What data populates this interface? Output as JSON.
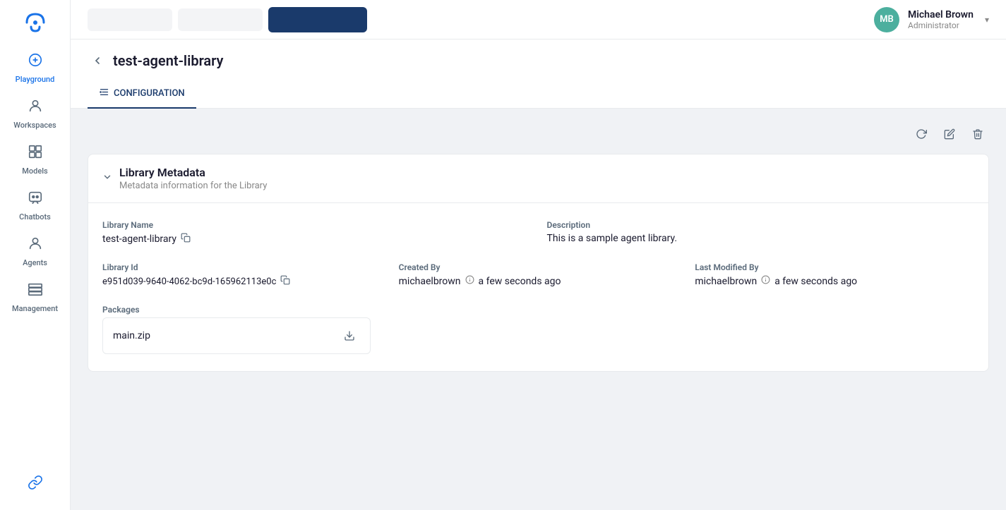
{
  "app": {
    "logo_alt": "AI Logo"
  },
  "user": {
    "initials": "MB",
    "name": "Michael Brown",
    "role": "Administrator"
  },
  "sidebar": {
    "items": [
      {
        "id": "playground",
        "label": "Playground",
        "icon": "💬",
        "active": true
      },
      {
        "id": "workspaces",
        "label": "Workspaces",
        "icon": "☁️",
        "active": false
      },
      {
        "id": "models",
        "label": "Models",
        "icon": "⊞",
        "active": false
      },
      {
        "id": "chatbots",
        "label": "Chatbots",
        "icon": "🤖",
        "active": false
      },
      {
        "id": "agents",
        "label": "Agents",
        "icon": "👤",
        "active": false
      },
      {
        "id": "management",
        "label": "Management",
        "icon": "🗂",
        "active": false
      }
    ],
    "bottom_items": [
      {
        "id": "links",
        "label": "Links",
        "icon": "🔗"
      }
    ]
  },
  "page": {
    "title": "test-agent-library",
    "back_label": "‹"
  },
  "tabs": [
    {
      "id": "configuration",
      "label": "CONFIGURATION",
      "active": true,
      "icon": "⚡"
    }
  ],
  "toolbar": {
    "refresh_label": "↻",
    "edit_label": "✏️",
    "delete_label": "🗑"
  },
  "library_metadata": {
    "section_title": "Library Metadata",
    "section_subtitle": "Metadata information for the Library",
    "library_name_label": "Library Name",
    "library_name_value": "test-agent-library",
    "description_label": "Description",
    "description_value": "This is a sample agent library.",
    "library_id_label": "Library Id",
    "library_id_value": "e951d039-9640-4062-bc9d-165962113e0c",
    "created_by_label": "Created By",
    "created_by_user": "michaelbrown",
    "created_by_time": "a few seconds ago",
    "last_modified_label": "Last Modified By",
    "last_modified_user": "michaelbrown",
    "last_modified_time": "a few seconds ago",
    "packages_label": "Packages",
    "package_name": "main.zip"
  }
}
